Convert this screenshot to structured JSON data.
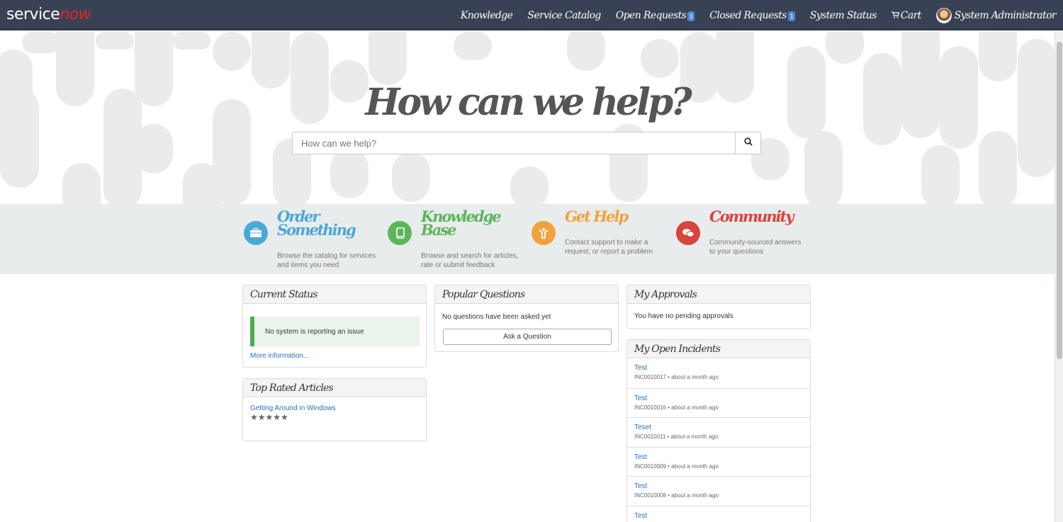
{
  "header": {
    "logo_part1": "service",
    "logo_part2": "now",
    "nav": [
      {
        "label": "Knowledge"
      },
      {
        "label": "Service Catalog"
      },
      {
        "label": "Open Requests",
        "badge": "1"
      },
      {
        "label": "Closed Requests",
        "badge": "1"
      },
      {
        "label": "System Status"
      },
      {
        "label": "Cart"
      },
      {
        "label": "System Administrator"
      }
    ]
  },
  "hero": {
    "title": "How can we help?",
    "search_placeholder": "How can we help?"
  },
  "quick_links": [
    {
      "title": "Order Something",
      "desc": "Browse the catalog for services and items you need",
      "color": "#4aa9d6",
      "icon": "briefcase-icon"
    },
    {
      "title": "Knowledge Base",
      "desc": "Browse and search for articles, rate or submit feedback",
      "color": "#5cb55d",
      "icon": "book-icon"
    },
    {
      "title": "Get Help",
      "desc": "Contact support to make a request, or report a problem",
      "color": "#f0a33a",
      "icon": "help-person-icon"
    },
    {
      "title": "Community",
      "desc": "Community-sourced answers to your questions",
      "color": "#d9433c",
      "icon": "chat-bubbles-icon"
    }
  ],
  "current_status": {
    "title": "Current Status",
    "message": "No system is reporting an issue",
    "more": "More information..."
  },
  "top_rated": {
    "title": "Top Rated Articles",
    "article": "Getting Around in Windows",
    "stars": "★★★★★"
  },
  "popular_questions": {
    "title": "Popular Questions",
    "empty": "No questions have been asked yet",
    "button": "Ask a Question"
  },
  "approvals": {
    "title": "My Approvals",
    "empty": "You have no pending approvals"
  },
  "incidents": {
    "title": "My Open Incidents",
    "items": [
      {
        "title": "Test",
        "meta": "INC0010017 • about a month ago"
      },
      {
        "title": "Test",
        "meta": "INC0010016 • about a month ago"
      },
      {
        "title": "Teset",
        "meta": "INC0010011 • about a month ago"
      },
      {
        "title": "Test",
        "meta": "INC0010009 • about a month ago"
      },
      {
        "title": "Test",
        "meta": "INC0010008 • about a month ago"
      },
      {
        "title": "Test",
        "meta": ""
      }
    ]
  }
}
